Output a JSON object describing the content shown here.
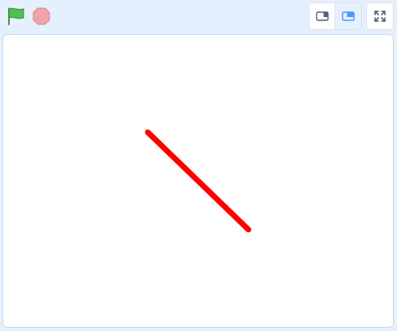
{
  "controls": {
    "green_flag": {
      "icon": "green-flag-icon",
      "color": "#4cbf56"
    },
    "stop": {
      "icon": "stop-sign-icon",
      "color": "#e8a0a6"
    }
  },
  "stage_modes": {
    "small": {
      "icon": "small-stage-icon",
      "active": false
    },
    "large": {
      "icon": "large-stage-icon",
      "active": true
    },
    "fullscreen": {
      "icon": "fullscreen-icon"
    }
  },
  "stage": {
    "drawing": {
      "type": "pen-line",
      "color": "#ff0000"
    }
  },
  "colors": {
    "header_background": "#e5f0ff",
    "accent": "#4c97ff",
    "stage_background": "#ffffff"
  }
}
